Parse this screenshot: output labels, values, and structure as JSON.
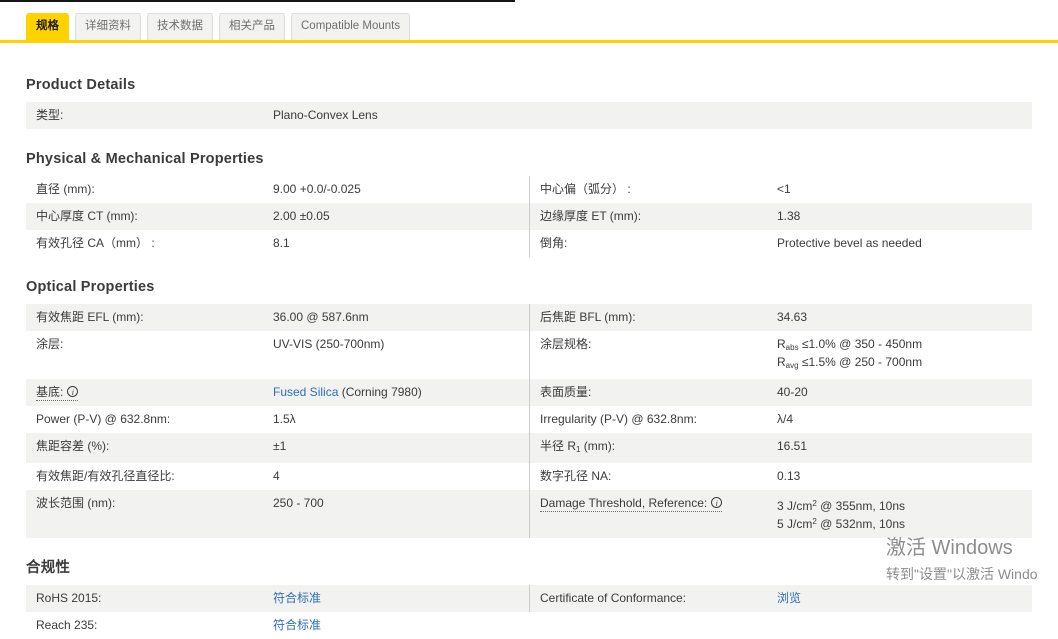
{
  "brand": {
    "accent_yellow": "#FFD200",
    "link_blue": "#2E6FB7",
    "row_gray": "#F2F2F1"
  },
  "tabs": [
    {
      "id": "specs",
      "label": "规格",
      "active": true
    },
    {
      "id": "detailed-info",
      "label": "详细资料",
      "active": false
    },
    {
      "id": "technical-data",
      "label": "技术数据",
      "active": false
    },
    {
      "id": "related-products",
      "label": "相关产品",
      "active": false
    },
    {
      "id": "compatible-mounts",
      "label": "Compatible Mounts",
      "active": false
    }
  ],
  "sections": [
    {
      "id": "product-details",
      "title": "Product Details",
      "split": false,
      "rows": [
        {
          "shade": "gray",
          "cells": [
            {
              "label": [
                {
                  "t": "类型:"
                }
              ],
              "value": [
                [
                  {
                    "t": "Plano-Convex Lens"
                  }
                ]
              ]
            }
          ]
        }
      ]
    },
    {
      "id": "physical-mechanical-properties",
      "title": "Physical & Mechanical Properties",
      "split": true,
      "rows": [
        {
          "shade": "white",
          "cells": [
            {
              "label": [
                {
                  "t": "直径 (mm):"
                }
              ],
              "value": [
                [
                  {
                    "t": "9.00 +0.0/-0.025"
                  }
                ]
              ]
            },
            {
              "label": [
                {
                  "t": "中心偏（弧分） :"
                }
              ],
              "value": [
                [
                  {
                    "t": "<1"
                  }
                ]
              ]
            }
          ]
        },
        {
          "shade": "gray",
          "cells": [
            {
              "label": [
                {
                  "t": "中心厚度 CT (mm):"
                }
              ],
              "value": [
                [
                  {
                    "t": "2.00 ±0.05"
                  }
                ]
              ]
            },
            {
              "label": [
                {
                  "t": "边缘厚度 ET (mm):"
                }
              ],
              "value": [
                [
                  {
                    "t": "1.38"
                  }
                ]
              ]
            }
          ]
        },
        {
          "shade": "white",
          "cells": [
            {
              "label": [
                {
                  "t": "有效孔径 CA（mm） :"
                }
              ],
              "value": [
                [
                  {
                    "t": "8.1"
                  }
                ]
              ]
            },
            {
              "label": [
                {
                  "t": "倒角:"
                }
              ],
              "value": [
                [
                  {
                    "t": "Protective bevel as needed"
                  }
                ]
              ]
            }
          ]
        }
      ]
    },
    {
      "id": "optical-properties",
      "title": "Optical Properties",
      "split": true,
      "rows": [
        {
          "shade": "gray",
          "cells": [
            {
              "label": [
                {
                  "t": "有效焦距 EFL (mm):"
                }
              ],
              "value": [
                [
                  {
                    "t": "36.00 @ 587.6nm"
                  }
                ]
              ]
            },
            {
              "label": [
                {
                  "t": "后焦距 BFL (mm):"
                }
              ],
              "value": [
                [
                  {
                    "t": "34.63"
                  }
                ]
              ]
            }
          ]
        },
        {
          "shade": "white",
          "cells": [
            {
              "label": [
                {
                  "t": "涂层:"
                }
              ],
              "value": [
                [
                  {
                    "t": "UV-VIS (250-700nm)"
                  }
                ]
              ]
            },
            {
              "label": [
                {
                  "t": "涂层规格:"
                }
              ],
              "value": [
                [
                  {
                    "t": "R"
                  },
                  {
                    "t": "abs",
                    "sub": true
                  },
                  {
                    "t": " ≤1.0% @ 350 - 450nm"
                  }
                ],
                [
                  {
                    "t": "R"
                  },
                  {
                    "t": "avg",
                    "sub": true
                  },
                  {
                    "t": " ≤1.5% @ 250 - 700nm"
                  }
                ]
              ]
            }
          ]
        },
        {
          "shade": "gray",
          "cells": [
            {
              "label": [
                {
                  "t": "基底:"
                }
              ],
              "info": true,
              "value": [
                [
                  {
                    "t": "Fused Silica",
                    "link": true
                  },
                  {
                    "t": " (Corning 7980)"
                  }
                ]
              ]
            },
            {
              "label": [
                {
                  "t": "表面质量:"
                }
              ],
              "value": [
                [
                  {
                    "t": "40-20"
                  }
                ]
              ]
            }
          ]
        },
        {
          "shade": "white",
          "cells": [
            {
              "label": [
                {
                  "t": "Power (P-V) @ 632.8nm:"
                }
              ],
              "value": [
                [
                  {
                    "t": "1.5λ"
                  }
                ]
              ]
            },
            {
              "label": [
                {
                  "t": "Irregularity (P-V) @ 632.8nm:"
                }
              ],
              "value": [
                [
                  {
                    "t": "λ/4"
                  }
                ]
              ]
            }
          ]
        },
        {
          "shade": "gray",
          "cells": [
            {
              "label": [
                {
                  "t": "焦距容差 (%):"
                }
              ],
              "value": [
                [
                  {
                    "t": "±1"
                  }
                ]
              ]
            },
            {
              "label": [
                {
                  "t": "半径 R"
                },
                {
                  "t": "1",
                  "sub": true
                },
                {
                  "t": " (mm):"
                }
              ],
              "value": [
                [
                  {
                    "t": "16.51"
                  }
                ]
              ]
            }
          ]
        },
        {
          "shade": "white",
          "cells": [
            {
              "label": [
                {
                  "t": "有效焦距/有效孔径直径比:"
                }
              ],
              "value": [
                [
                  {
                    "t": "4"
                  }
                ]
              ]
            },
            {
              "label": [
                {
                  "t": "数字孔径 NA:"
                }
              ],
              "value": [
                [
                  {
                    "t": "0.13"
                  }
                ]
              ]
            }
          ]
        },
        {
          "shade": "gray",
          "cells": [
            {
              "label": [
                {
                  "t": "波长范围 (nm):"
                }
              ],
              "value": [
                [
                  {
                    "t": "250 - 700"
                  }
                ]
              ]
            },
            {
              "label": [
                {
                  "t": "Damage Threshold, Reference:"
                }
              ],
              "info": true,
              "value": [
                [
                  {
                    "t": "3 J/cm"
                  },
                  {
                    "t": "2",
                    "sup": true
                  },
                  {
                    "t": " @ 355nm, 10ns"
                  }
                ],
                [
                  {
                    "t": "5 J/cm"
                  },
                  {
                    "t": "2",
                    "sup": true
                  },
                  {
                    "t": " @ 532nm, 10ns"
                  }
                ]
              ]
            }
          ]
        }
      ]
    },
    {
      "id": "compliance",
      "title": "合规性",
      "split": true,
      "rows": [
        {
          "shade": "gray",
          "cells": [
            {
              "label": [
                {
                  "t": "RoHS 2015:"
                }
              ],
              "value": [
                [
                  {
                    "t": "符合标准",
                    "link": true
                  }
                ]
              ]
            },
            {
              "label": [
                {
                  "t": "Certificate of Conformance:"
                }
              ],
              "value": [
                [
                  {
                    "t": "浏览",
                    "link": true
                  }
                ]
              ]
            }
          ]
        },
        {
          "shade": "white",
          "cells": [
            {
              "label": [
                {
                  "t": "Reach 235:"
                }
              ],
              "value": [
                [
                  {
                    "t": "符合标准",
                    "link": true
                  }
                ]
              ]
            },
            null
          ]
        }
      ]
    }
  ],
  "watermark": {
    "line1": "激活 Windows",
    "line2": "转到\"设置\"以激活 Windo"
  }
}
